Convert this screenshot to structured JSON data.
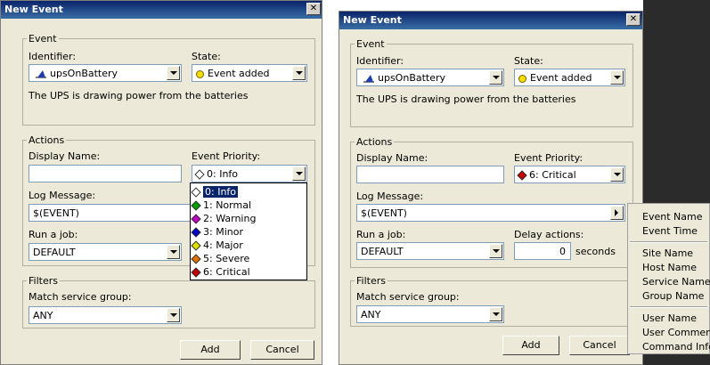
{
  "left": {
    "title": "New Event",
    "close_symbol": "✕",
    "event": {
      "legend": "Event",
      "identifier_label": "Identifier:",
      "identifier_value": "upsOnBattery",
      "state_label": "State:",
      "state_value": "Event added",
      "description": "The UPS is drawing power from the batteries"
    },
    "actions": {
      "legend": "Actions",
      "display_name_label": "Display Name:",
      "display_name_value": "",
      "priority_label": "Event Priority:",
      "priority_value": "0: Info",
      "log_message_label": "Log Message:",
      "log_message_value": "$(EVENT)",
      "run_job_label": "Run a job:",
      "run_job_value": "DEFAULT"
    },
    "priority_options": [
      {
        "label": "0: Info",
        "color": "#ffffff"
      },
      {
        "label": "1: Normal",
        "color": "#00a000"
      },
      {
        "label": "2: Warning",
        "color": "#c000c0"
      },
      {
        "label": "3: Minor",
        "color": "#0000c0"
      },
      {
        "label": "4: Major",
        "color": "#e0e000"
      },
      {
        "label": "5: Severe",
        "color": "#e07000"
      },
      {
        "label": "6: Critical",
        "color": "#c00000"
      }
    ],
    "filters": {
      "legend": "Filters",
      "match_label": "Match service group:",
      "match_value": "ANY"
    },
    "add_label": "Add",
    "cancel_label": "Cancel"
  },
  "right": {
    "title": "New Event",
    "close_symbol": "✕",
    "event": {
      "legend": "Event",
      "identifier_label": "Identifier:",
      "identifier_value": "upsOnBattery",
      "state_label": "State:",
      "state_value": "Event added",
      "description": "The UPS is drawing power from the batteries"
    },
    "actions": {
      "legend": "Actions",
      "display_name_label": "Display Name:",
      "display_name_value": "",
      "priority_label": "Event Priority:",
      "priority_value": "6: Critical",
      "log_message_label": "Log Message:",
      "log_message_value": "$(EVENT)",
      "run_job_label": "Run a job:",
      "run_job_value": "DEFAULT",
      "delay_label": "Delay actions:",
      "delay_value": "0",
      "delay_unit": "seconds"
    },
    "filters": {
      "legend": "Filters",
      "match_label": "Match service group:",
      "match_value": "ANY"
    },
    "add_label": "Add",
    "cancel_label": "Cancel",
    "context_menu": {
      "group1": [
        "Event Name",
        "Event Time"
      ],
      "group2": [
        "Site Name",
        "Host Name",
        "Service Name",
        "Group Name"
      ],
      "group3": [
        "User Name",
        "User Comment",
        "Command Info"
      ]
    }
  },
  "colors": {
    "title_bar": "#0a246a",
    "dialog_bg": "#ece9d8",
    "selection": "#0a246a",
    "dark_backdrop": "#2b2b2b"
  }
}
